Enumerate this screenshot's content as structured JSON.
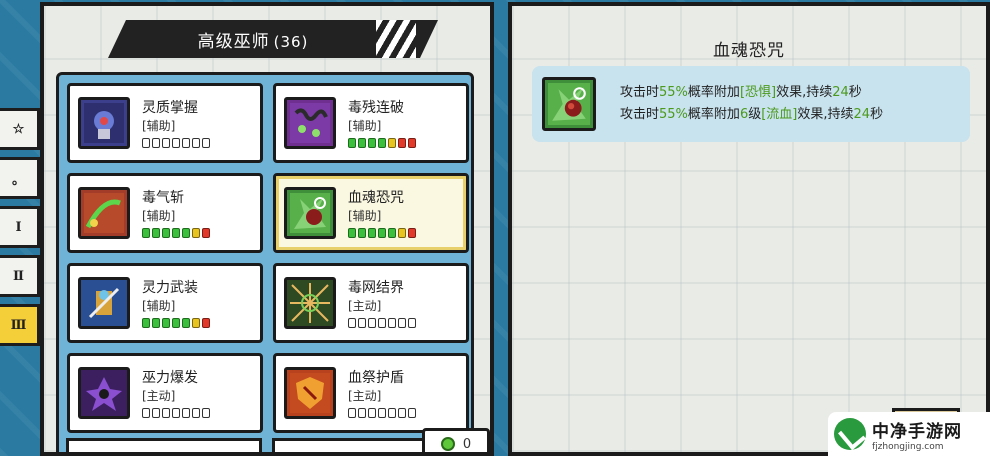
{
  "side_tabs": [
    {
      "label": "☆",
      "active": false
    },
    {
      "label": "。",
      "active": false
    },
    {
      "label": "Ⅰ",
      "active": false
    },
    {
      "label": "Ⅱ",
      "active": false
    },
    {
      "label": "Ⅲ",
      "active": true
    }
  ],
  "left_panel": {
    "title": "高级巫师",
    "count": "(36)"
  },
  "skills": [
    {
      "name": "灵质掌握",
      "type": "[辅助]",
      "icon": "spirit-mastery-icon",
      "bar": [
        "e",
        "e",
        "e",
        "e",
        "e",
        "e",
        "e"
      ],
      "bg": "#3b3f8c",
      "selected": false
    },
    {
      "name": "毒残连破",
      "type": "[辅助]",
      "icon": "poison-chain-icon",
      "bar": [
        "g",
        "g",
        "g",
        "g",
        "y",
        "r",
        "r"
      ],
      "bg": "#6e2f91",
      "selected": false
    },
    {
      "name": "毒气斩",
      "type": "[辅助]",
      "icon": "poison-slash-icon",
      "bar": [
        "g",
        "g",
        "g",
        "g",
        "g",
        "y",
        "r"
      ],
      "bg": "#a33c28",
      "selected": false
    },
    {
      "name": "血魂恐咒",
      "type": "[辅助]",
      "icon": "blood-curse-icon",
      "bar": [
        "g",
        "g",
        "g",
        "g",
        "g",
        "y",
        "r"
      ],
      "bg": "#3f8f3a",
      "selected": true
    },
    {
      "name": "灵力武装",
      "type": "[辅助]",
      "icon": "spirit-armor-icon",
      "bar": [
        "g",
        "g",
        "g",
        "g",
        "g",
        "y",
        "r"
      ],
      "bg": "#2a4f93",
      "selected": false
    },
    {
      "name": "毒网结界",
      "type": "[主动]",
      "icon": "poison-web-icon",
      "bar": [
        "e",
        "e",
        "e",
        "e",
        "e",
        "e",
        "e"
      ],
      "bg": "#2e4a23",
      "selected": false
    },
    {
      "name": "巫力爆发",
      "type": "[主动]",
      "icon": "witch-burst-icon",
      "bar": [
        "e",
        "e",
        "e",
        "e",
        "e",
        "e",
        "e"
      ],
      "bg": "#3b1f5e",
      "selected": false
    },
    {
      "name": "血祭护盾",
      "type": "[主动]",
      "icon": "blood-shield-icon",
      "bar": [
        "e",
        "e",
        "e",
        "e",
        "e",
        "e",
        "e"
      ],
      "bg": "#b8421e",
      "selected": false
    }
  ],
  "currency": {
    "value": "0"
  },
  "detail": {
    "title": "血魂恐咒",
    "line1_a": "攻击时",
    "line1_b": "55%",
    "line1_c": "概率附加",
    "line1_d": "[恐惧]",
    "line1_e": "效果,持续",
    "line1_f": "24",
    "line1_g": "秒",
    "line2_a": "攻击时",
    "line2_b": "55%",
    "line2_c": "概率附加",
    "line2_d": "6",
    "line2_e": "级",
    "line2_f": "[流血]",
    "line2_g": "效果,持续",
    "line2_h": "24",
    "line2_i": "秒"
  },
  "watermark": {
    "main": "中净手游网",
    "sub": "fjzhongjing.com"
  },
  "colors": {
    "accent_green": "#4c9a1c",
    "panel_border": "#1b1b1b",
    "grid_bg": "#6fb4d6"
  }
}
